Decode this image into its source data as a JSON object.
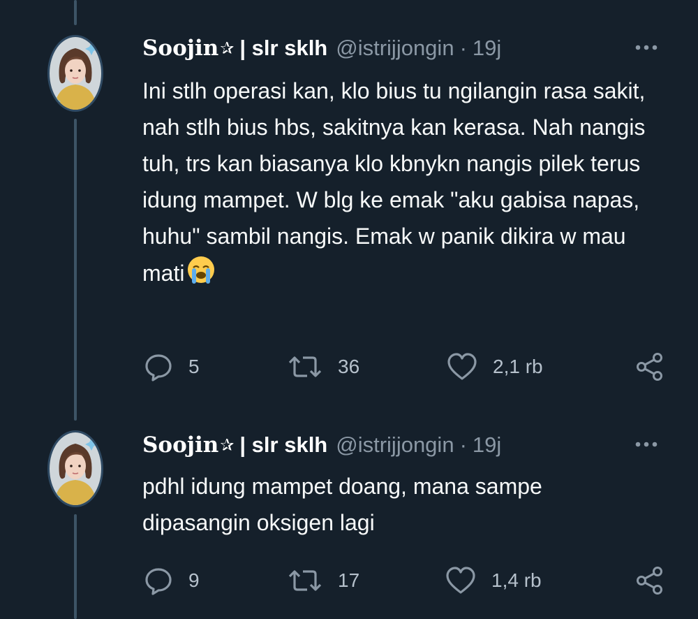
{
  "tweets": [
    {
      "display_name": "Soojin",
      "display_name_suffix": "✰",
      "name_rest": "| slr sklh",
      "handle": "@istrijjongin",
      "separator": "·",
      "time": "19j",
      "text": "Ini stlh operasi kan, klo bius tu ngilangin rasa sakit, nah stlh bius hbs, sakitnya kan kerasa. Nah nangis tuh, trs kan biasanya klo kbnykn nangis pilek terus idung mampet. W blg ke emak \"aku gabisa napas, huhu\" sambil nangis. Emak w panik dikira w mau mati",
      "text_emoji": "loudly-crying-face",
      "replies": "5",
      "retweets": "36",
      "likes": "2,1 rb"
    },
    {
      "display_name": "Soojin",
      "display_name_suffix": "✰",
      "name_rest": "| slr sklh",
      "handle": "@istrijjongin",
      "separator": "·",
      "time": "19j",
      "text": "pdhl idung mampet doang, mana sampe dipasangin oksigen lagi",
      "replies": "9",
      "retweets": "17",
      "likes": "1,4 rb"
    }
  ],
  "icons": {
    "more": "more-horizontal-icon",
    "reply": "reply-icon",
    "retweet": "retweet-icon",
    "like": "heart-icon",
    "share": "share-icon"
  },
  "colors": {
    "background": "#15202b",
    "secondary_text": "#8b98a5",
    "thread_line": "#3d5466"
  }
}
